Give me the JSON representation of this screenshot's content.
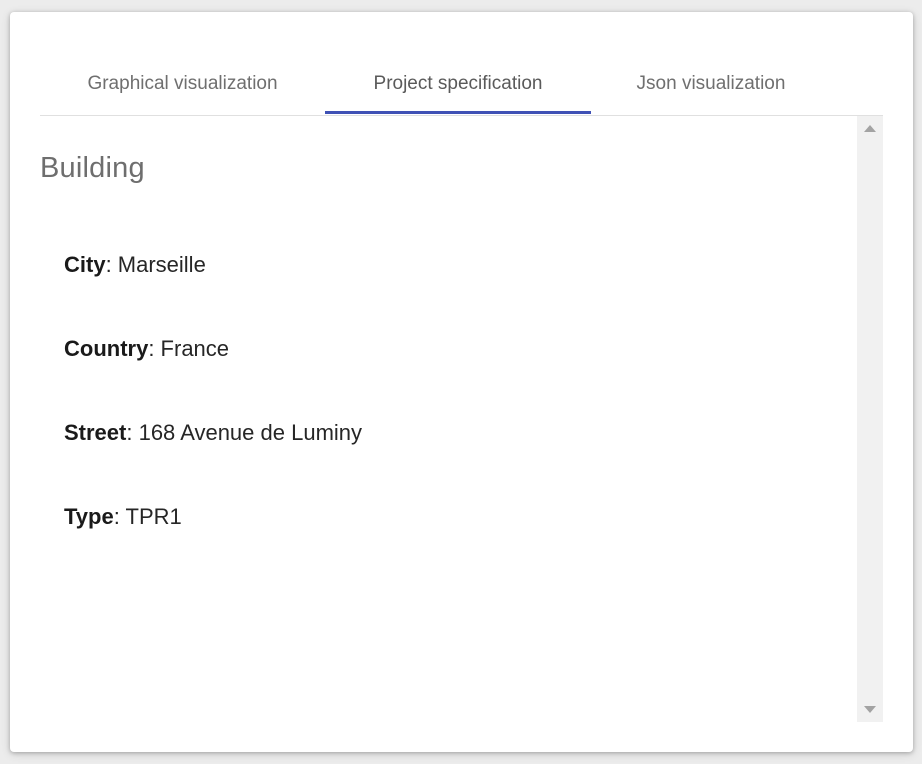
{
  "tabs": [
    {
      "label": "Graphical visualization",
      "active": false
    },
    {
      "label": "Project specification",
      "active": true
    },
    {
      "label": "Json visualization",
      "active": false
    }
  ],
  "section": {
    "title": "Building",
    "fields": [
      {
        "key": "City",
        "value": ": Marseille"
      },
      {
        "key": "Country",
        "value": ": France"
      },
      {
        "key": "Street",
        "value": ": 168 Avenue de Luminy"
      },
      {
        "key": "Type",
        "value": ": TPR1"
      }
    ]
  },
  "colors": {
    "active_tab_indicator": "#3f51b5",
    "tab_text": "#6f6f6f",
    "section_title": "#6e6e6e",
    "scrollbar_track": "#f1f1f1"
  },
  "icons": {
    "scroll_up": "triangle-up-icon",
    "scroll_down": "triangle-down-icon"
  }
}
